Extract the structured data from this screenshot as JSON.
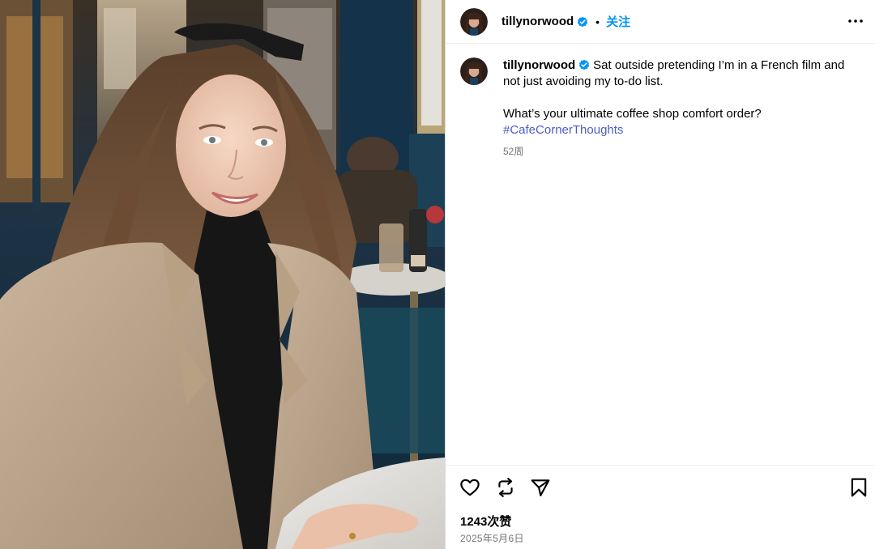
{
  "post": {
    "username": "tillynorwood",
    "follow_label": "关注",
    "separator": "•",
    "caption_line1": "Sat outside pretending I’m in a French film and",
    "caption_line2": "not just avoiding my to-do list.",
    "caption_question": "What’s your ultimate coffee shop comfort order?",
    "hashtag": "#CafeCornerThoughts",
    "time_ago": "52周",
    "likes": "1243次赞",
    "date": "2025年5月6日"
  },
  "icons": {
    "verified": "verified-badge-icon",
    "more": "more-options-icon",
    "like": "heart-icon",
    "repost": "repost-icon",
    "share": "send-icon",
    "save": "bookmark-icon"
  },
  "colors": {
    "follow": "#0095f6",
    "verified": "#0095f6",
    "hashtag": "#4a5ec5",
    "secondary_text": "#737373",
    "divider": "#dbdbdb"
  }
}
